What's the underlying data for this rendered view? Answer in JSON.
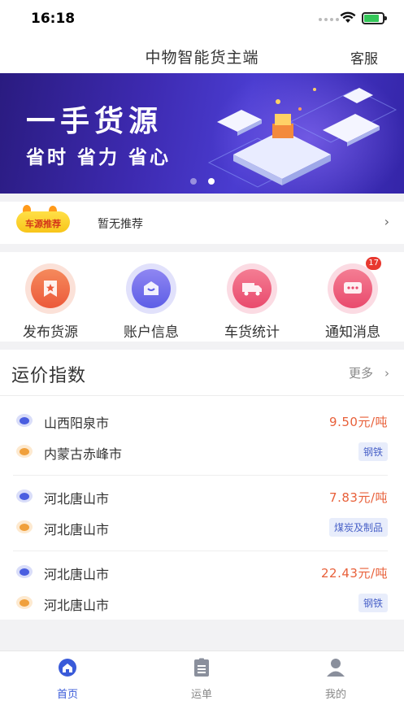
{
  "status_bar": {
    "time": "16:18"
  },
  "header": {
    "title": "中物智能货主端",
    "service_label": "客服"
  },
  "banner": {
    "headline": "一手货源",
    "subline": "省时 省力 省心",
    "active_page": 2,
    "page_count": 2
  },
  "recommend": {
    "badge_label": "车源推荐",
    "text": "暂无推荐"
  },
  "quick_menu": [
    {
      "label": "发布货源",
      "icon": "star-flag-icon",
      "color": "#ef6b4a"
    },
    {
      "label": "账户信息",
      "icon": "wallet-icon",
      "color": "#6a6fe8"
    },
    {
      "label": "车货统计",
      "icon": "truck-icon",
      "color": "#ee5a78"
    },
    {
      "label": "通知消息",
      "icon": "message-icon",
      "color": "#ee5a78",
      "badge": "17"
    }
  ],
  "freight_index": {
    "title": "运价指数",
    "more_label": "更多",
    "routes": [
      {
        "from": "山西阳泉市",
        "to": "内蒙古赤峰市",
        "price": "9.50元/吨",
        "category": "钢铁"
      },
      {
        "from": "河北唐山市",
        "to": "河北唐山市",
        "price": "7.83元/吨",
        "category": "煤炭及制品"
      },
      {
        "from": "河北唐山市",
        "to": "河北唐山市",
        "price": "22.43元/吨",
        "category": "钢铁"
      }
    ]
  },
  "tab_bar": {
    "tabs": [
      {
        "label": "首页",
        "icon": "home-icon",
        "active": true
      },
      {
        "label": "运单",
        "icon": "waybill-icon",
        "active": false
      },
      {
        "label": "我的",
        "icon": "user-icon",
        "active": false
      }
    ]
  },
  "colors": {
    "primary": "#3a5bd9",
    "price": "#e8603a",
    "origin_dot": "#4a5ee0",
    "dest_dot": "#f0a03c"
  }
}
